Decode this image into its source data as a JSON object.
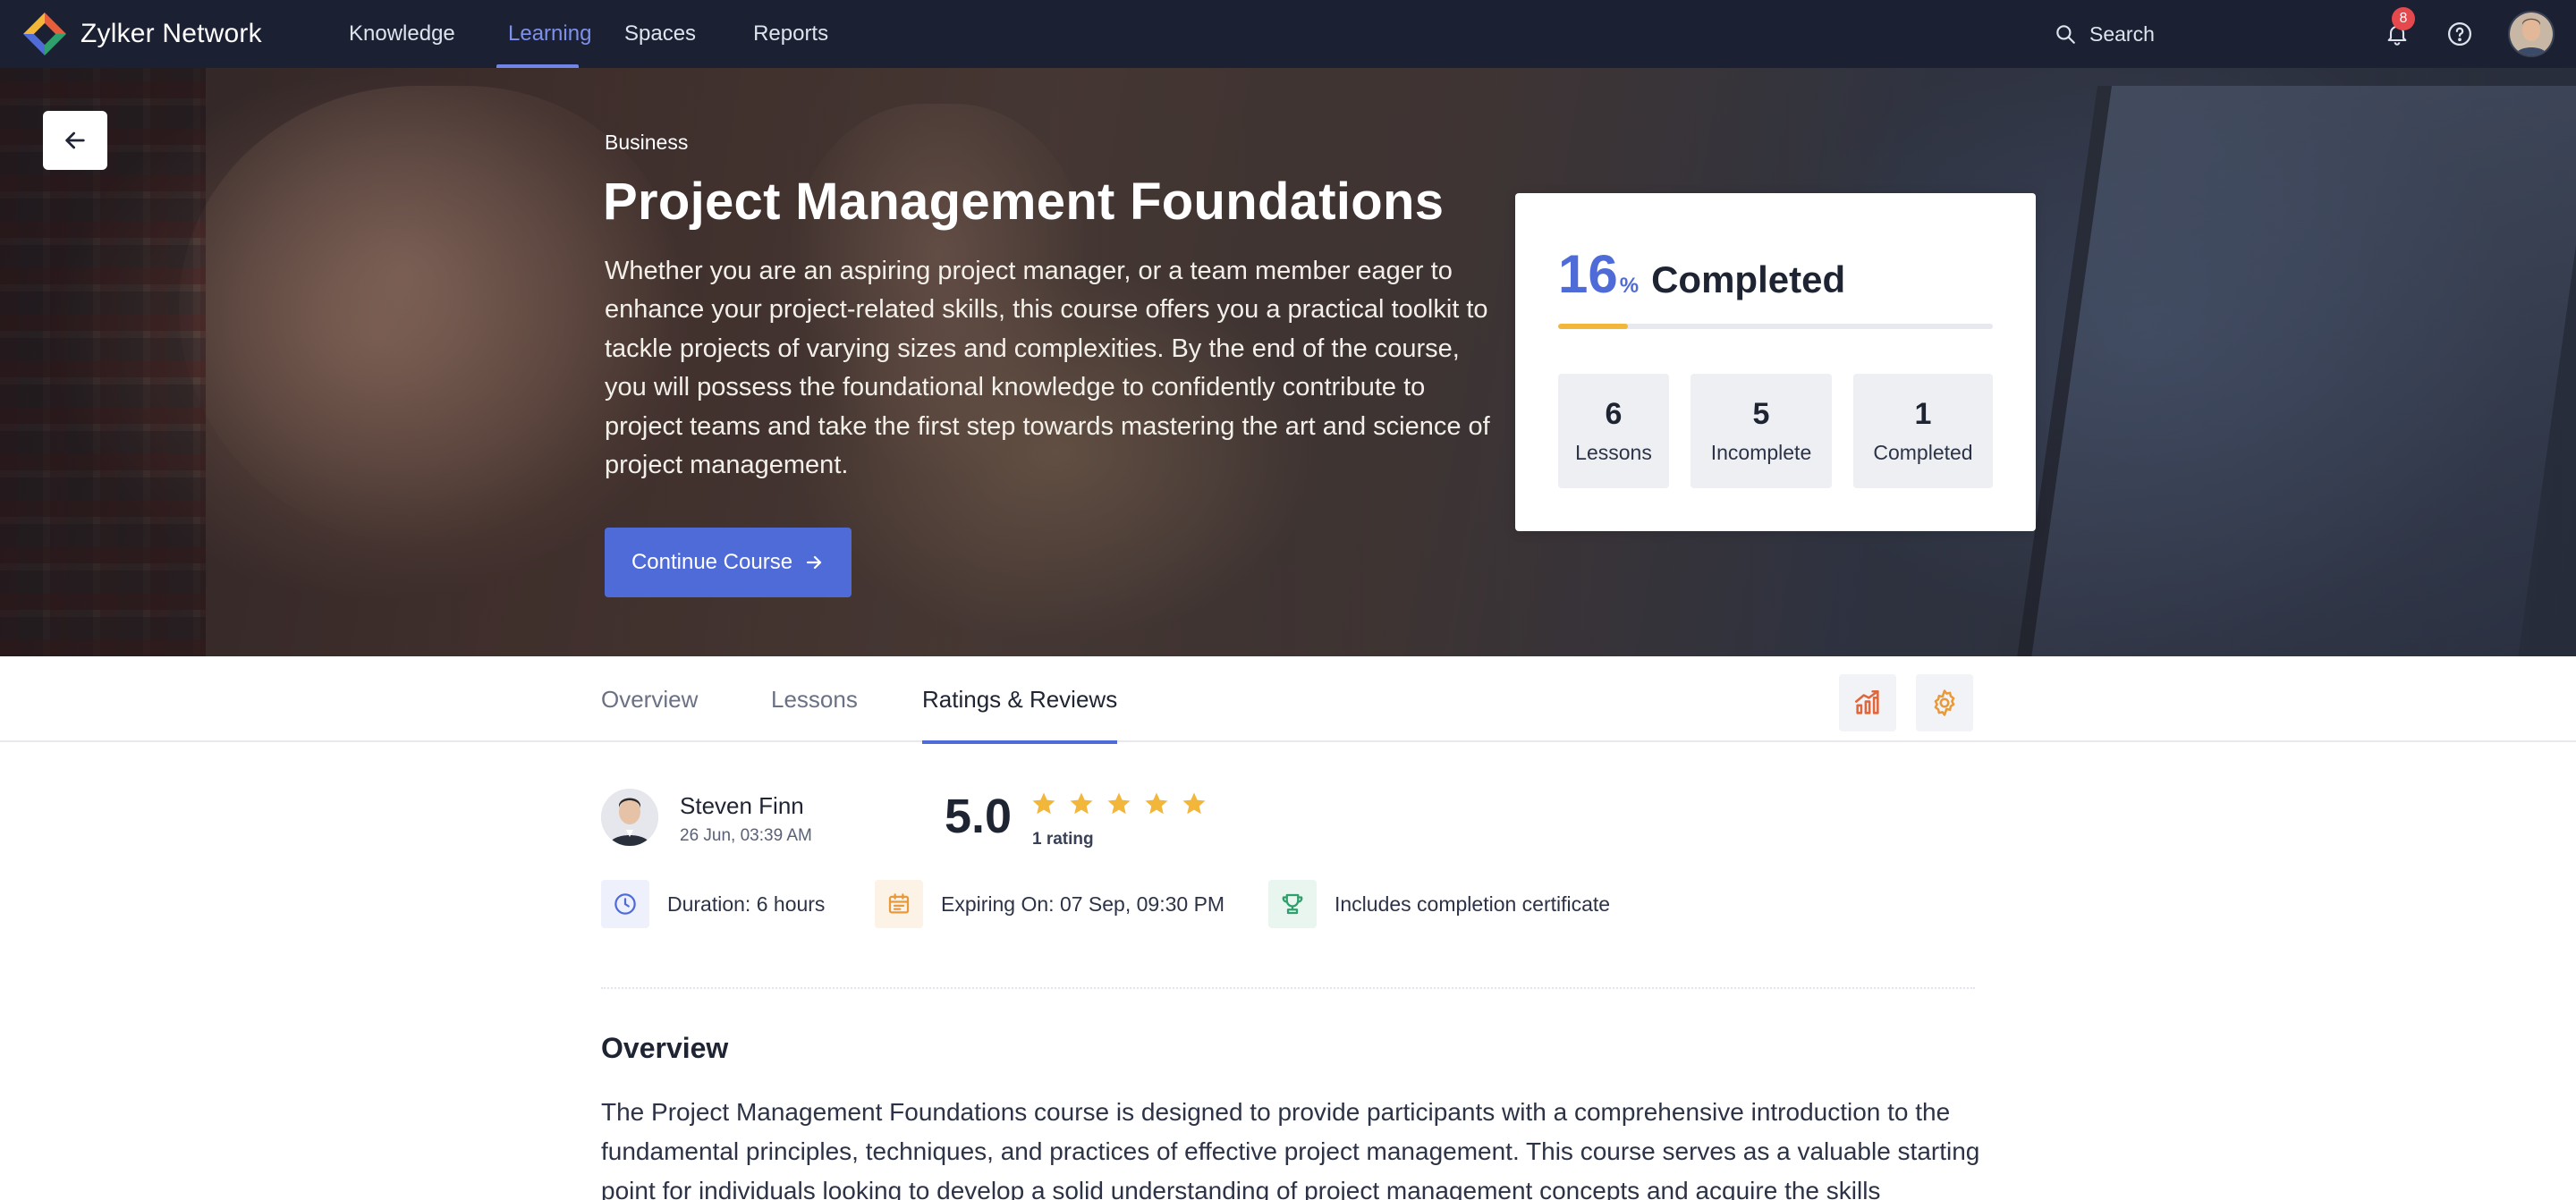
{
  "app": {
    "name": "Zylker Network"
  },
  "nav": {
    "items": [
      {
        "label": "Knowledge"
      },
      {
        "label": "Learning",
        "active": true
      },
      {
        "label": "Spaces"
      },
      {
        "label": "Reports"
      }
    ],
    "search_placeholder": "Search",
    "notifications_count": "8"
  },
  "course": {
    "category": "Business",
    "title": "Project Management Foundations",
    "description": "Whether you are an aspiring project manager, or a team member eager to enhance your project-related skills, this course offers you a practical toolkit to tackle projects of varying sizes and complexities. By the end of the course, you will possess the foundational knowledge to confidently contribute to project teams and take the first step towards mastering the art and science of project management.",
    "cta_label": "Continue Course"
  },
  "progress": {
    "percent": "16",
    "percent_sign": "%",
    "label": "Completed",
    "fraction": 0.16,
    "stats": [
      {
        "value": "6",
        "label": "Lessons"
      },
      {
        "value": "5",
        "label": "Incomplete"
      },
      {
        "value": "1",
        "label": "Completed"
      }
    ]
  },
  "tabs": [
    {
      "label": "Overview"
    },
    {
      "label": "Lessons"
    },
    {
      "label": "Ratings & Reviews",
      "active": true
    }
  ],
  "author": {
    "name": "Steven Finn",
    "date": "26 Jun, 03:39 AM"
  },
  "rating": {
    "score": "5.0",
    "stars": 5,
    "count_label": "1 rating"
  },
  "meta": {
    "duration": "Duration: 6 hours",
    "expiry": "Expiring On: 07 Sep, 09:30 PM",
    "certificate": "Includes completion certificate"
  },
  "overview": {
    "title": "Overview",
    "text": "The Project Management Foundations course is designed to provide participants with a comprehensive introduction to the fundamental principles, techniques, and practices of effective project management. This course serves as a valuable starting point for individuals looking to develop a solid understanding of project management concepts and acquire the skills necessary to"
  },
  "colors": {
    "nav_bg": "#1b2133",
    "accent": "#4f6bd8",
    "progress_fill": "#f2b63b",
    "star": "#f2b63b",
    "badge": "#e5484d"
  },
  "icons": [
    "logo-icon",
    "search-icon",
    "bell-icon",
    "help-icon",
    "back-arrow-icon",
    "arrow-right-icon",
    "chart-icon",
    "settings-icon",
    "clock-icon",
    "calendar-icon",
    "trophy-icon",
    "star-icon"
  ]
}
